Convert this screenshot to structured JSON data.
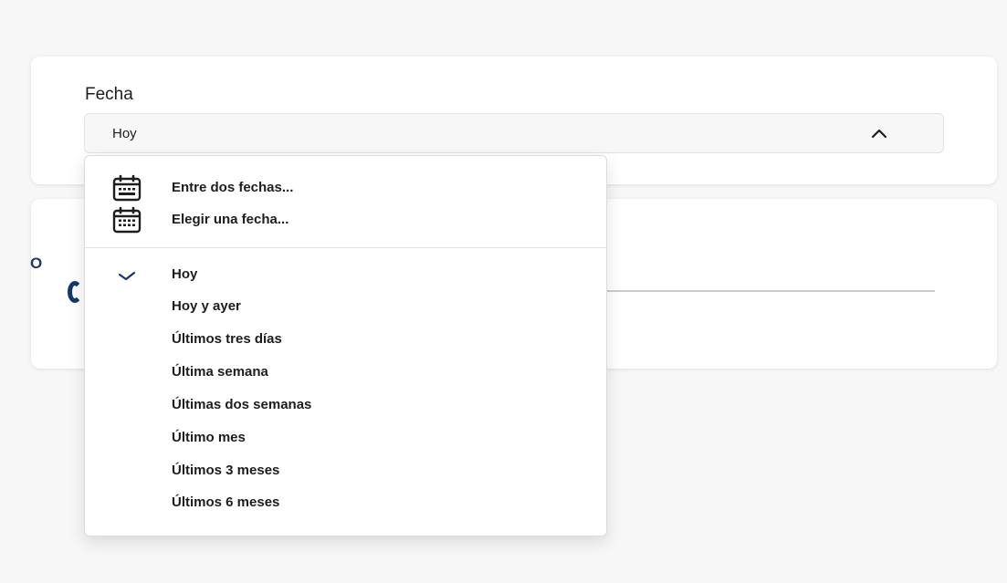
{
  "colors": {
    "page_background": "#f7f7f8",
    "card_background": "#ffffff",
    "accent_navy": "#14386d",
    "text": "#1d1d1f"
  },
  "date_filter": {
    "label": "Fecha",
    "selected_value": "Hoy",
    "chevron_icon": "chevron-up-icon"
  },
  "second_card": {
    "partial_title": "O"
  },
  "dropdown": {
    "custom_options": [
      {
        "label": "Entre dos fechas...",
        "icon": "calendar-range-icon"
      },
      {
        "label": "Elegir una fecha...",
        "icon": "calendar-icon"
      }
    ],
    "preset_options": [
      {
        "label": "Hoy",
        "selected": true
      },
      {
        "label": "Hoy y ayer",
        "selected": false
      },
      {
        "label": "Últimos tres días",
        "selected": false
      },
      {
        "label": "Última semana",
        "selected": false
      },
      {
        "label": "Últimas dos semanas",
        "selected": false
      },
      {
        "label": "Último mes",
        "selected": false
      },
      {
        "label": "Últimos 3 meses",
        "selected": false
      },
      {
        "label": "Últimos 6 meses",
        "selected": false
      }
    ]
  }
}
